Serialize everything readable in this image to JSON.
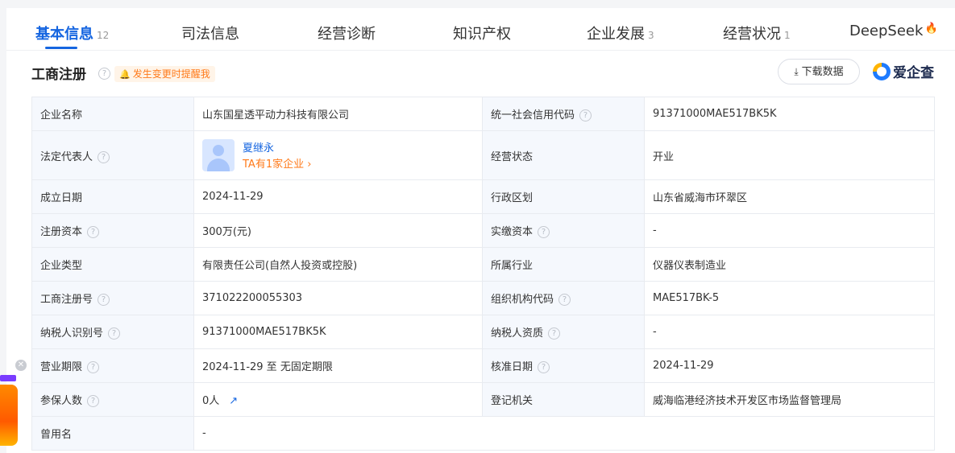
{
  "tabs": [
    {
      "label": "基本信息",
      "count": "12"
    },
    {
      "label": "司法信息",
      "count": ""
    },
    {
      "label": "经营诊断",
      "count": ""
    },
    {
      "label": "知识产权",
      "count": ""
    },
    {
      "label": "企业发展",
      "count": "3"
    },
    {
      "label": "经营状况",
      "count": "1"
    },
    {
      "label": "DeepSeek",
      "count": ""
    }
  ],
  "section": {
    "title": "工商注册",
    "remind": "发生变更时提醒我",
    "download": "下载数据",
    "logo_text": "爱企查"
  },
  "rows": [
    {
      "l1": "企业名称",
      "v1": "山东国星透平动力科技有限公司",
      "l2": "统一社会信用代码",
      "v2": "91371000MAE517BK5K"
    },
    {
      "l1": "法定代表人",
      "person_name": "夏继永",
      "person_link": "TA有1家企业",
      "l2": "经营状态",
      "v2": "开业"
    },
    {
      "l1": "成立日期",
      "v1": "2024-11-29",
      "l2": "行政区划",
      "v2": "山东省威海市环翠区"
    },
    {
      "l1": "注册资本",
      "v1": "300万(元)",
      "l2": "实缴资本",
      "v2": "-"
    },
    {
      "l1": "企业类型",
      "v1": "有限责任公司(自然人投资或控股)",
      "l2": "所属行业",
      "v2": "仪器仪表制造业"
    },
    {
      "l1": "工商注册号",
      "v1": "371022200055303",
      "l2": "组织机构代码",
      "v2": "MAE517BK-5"
    },
    {
      "l1": "纳税人识别号",
      "v1": "91371000MAE517BK5K",
      "l2": "纳税人资质",
      "v2": "-"
    },
    {
      "l1": "营业期限",
      "v1": "2024-11-29 至 无固定期限",
      "l2": "核准日期",
      "v2": "2024-11-29"
    },
    {
      "l1": "参保人数",
      "v1": "0人",
      "l2": "登记机关",
      "v2": "威海临港经济技术开发区市场监督管理局"
    },
    {
      "l1": "曾用名",
      "v1": "-"
    }
  ],
  "colors": {
    "accent": "#1565e0",
    "orange": "#ff7a1a",
    "label_bg": "#f5f8fd"
  },
  "icons": [
    "help-icon",
    "bell-icon",
    "download-icon",
    "fire-icon",
    "chevron-right-icon",
    "trend-chart-icon",
    "close-icon"
  ]
}
